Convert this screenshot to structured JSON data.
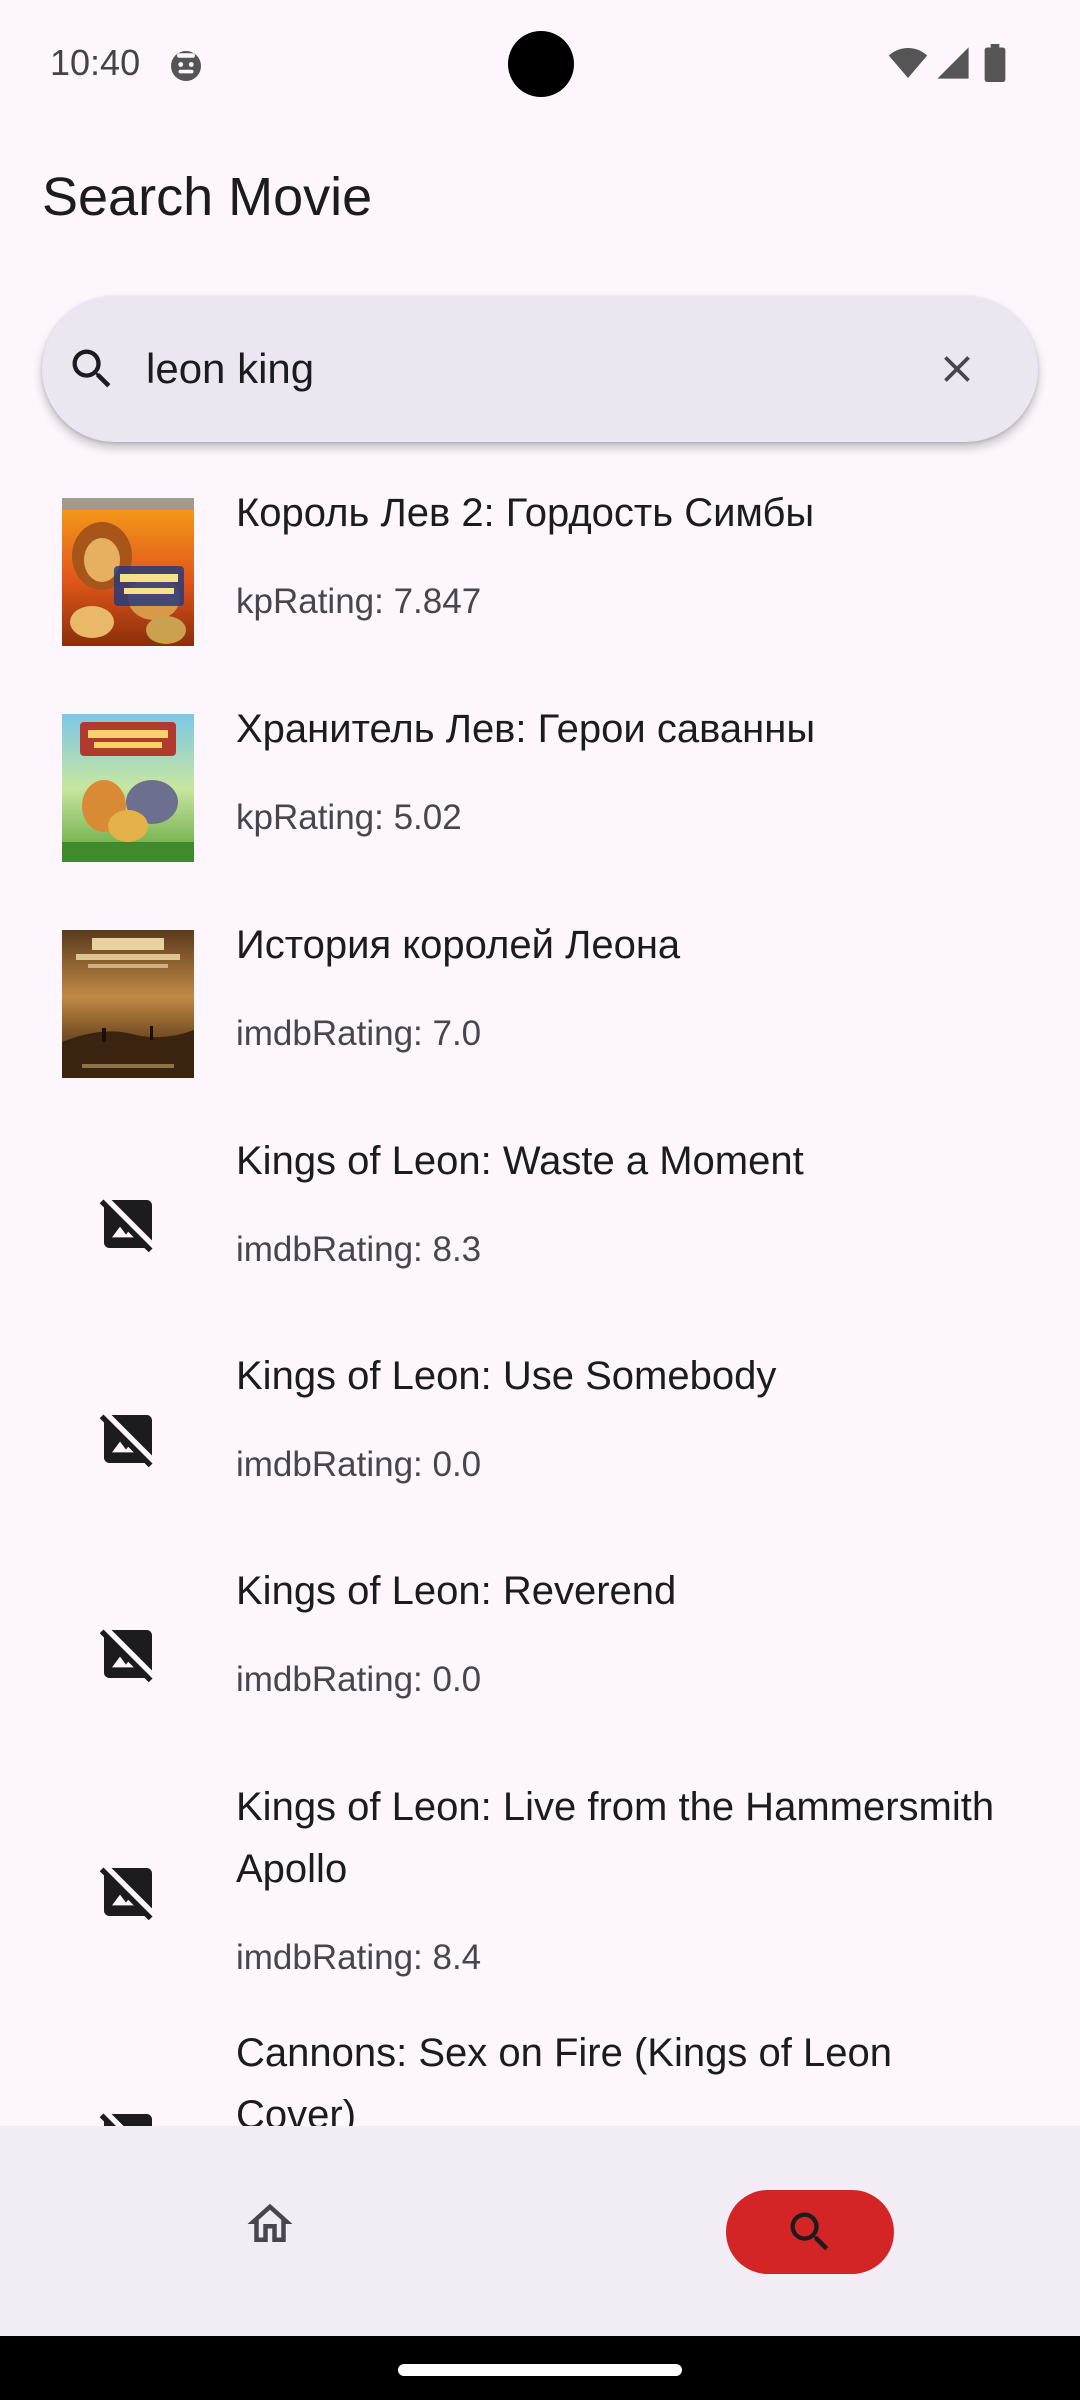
{
  "status_bar": {
    "time": "10:40"
  },
  "header": {
    "title": "Search Movie"
  },
  "search": {
    "query": "leon king"
  },
  "movies": [
    {
      "title": "Король Лев 2: Гордость Симбы",
      "rating": "kpRating: 7.847",
      "poster": "lion-king-2-poster"
    },
    {
      "title": "Хранитель Лев: Герои саванны",
      "rating": "kpRating: 5.02",
      "poster": "lion-guard-poster"
    },
    {
      "title": "История королей Леона",
      "rating": "imdbRating: 7.0",
      "poster": "kings-of-leon-sky-poster"
    },
    {
      "title": "Kings of Leon: Waste a Moment",
      "rating": "imdbRating: 8.3",
      "poster": "no-image-icon"
    },
    {
      "title": "Kings of Leon: Use Somebody",
      "rating": "imdbRating: 0.0",
      "poster": "no-image-icon"
    },
    {
      "title": "Kings of Leon: Reverend",
      "rating": "imdbRating: 0.0",
      "poster": "no-image-icon"
    },
    {
      "title": "Kings of Leon: Live from the Hammersmith Apollo",
      "rating": "imdbRating: 8.4",
      "poster": "no-image-icon"
    },
    {
      "title": "Cannons: Sex on Fire (Kings of Leon Cover)",
      "rating": "",
      "poster": "no-image-icon"
    }
  ],
  "bottom_nav": {
    "items": [
      {
        "icon": "home-icon",
        "selected": false
      },
      {
        "icon": "search-icon",
        "selected": true
      }
    ],
    "accent_color": "#d32525"
  }
}
